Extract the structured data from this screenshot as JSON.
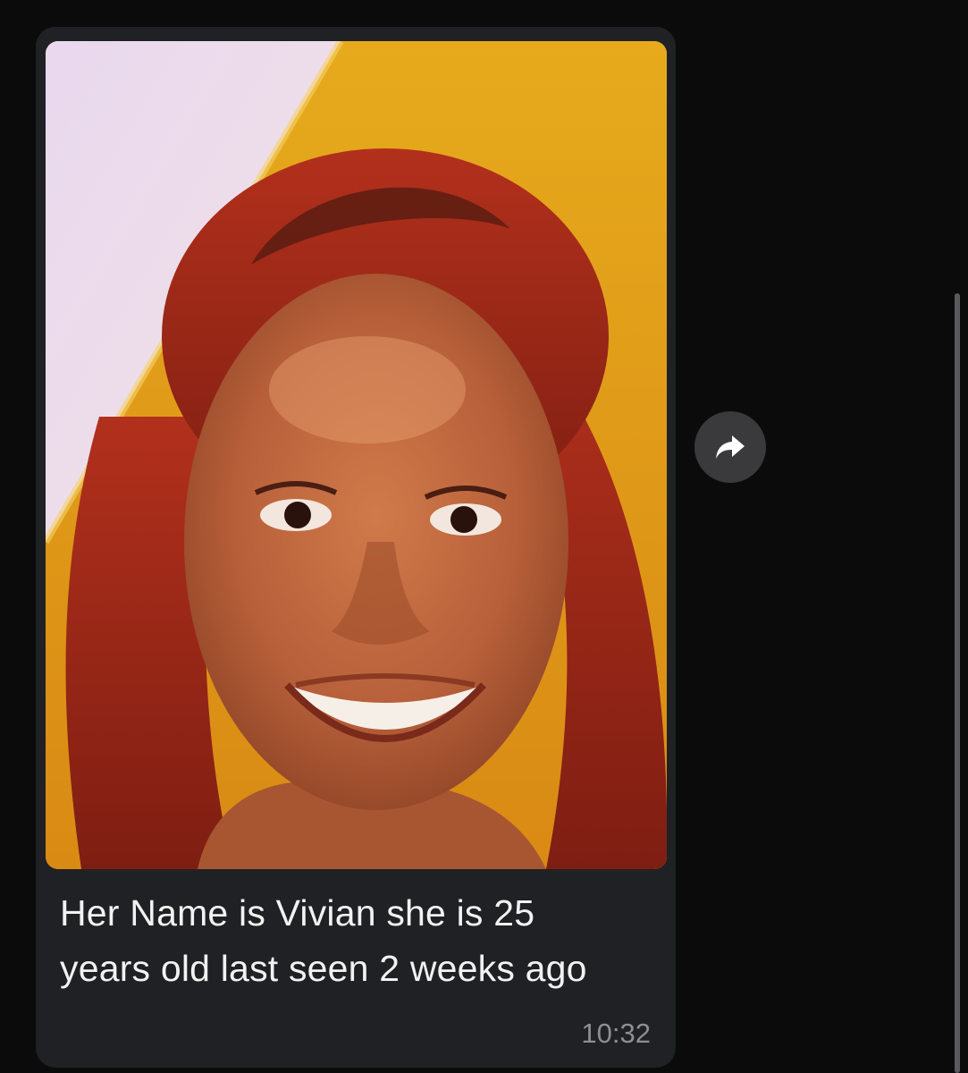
{
  "message": {
    "caption": "Her Name is Vivian she is 25 years old last seen 2 weeks ago",
    "time": "10:32",
    "photo": {
      "description_icon": "photo-image",
      "subject": "portrait-photo"
    }
  },
  "actions": {
    "forward_icon": "forward-arrow-icon"
  },
  "colors": {
    "background": "#0b0b0b",
    "bubble": "#202124",
    "caption_text": "#f2f2f2",
    "timestamp_text": "#8e8e93",
    "forward_button": "#3a3a3c"
  }
}
